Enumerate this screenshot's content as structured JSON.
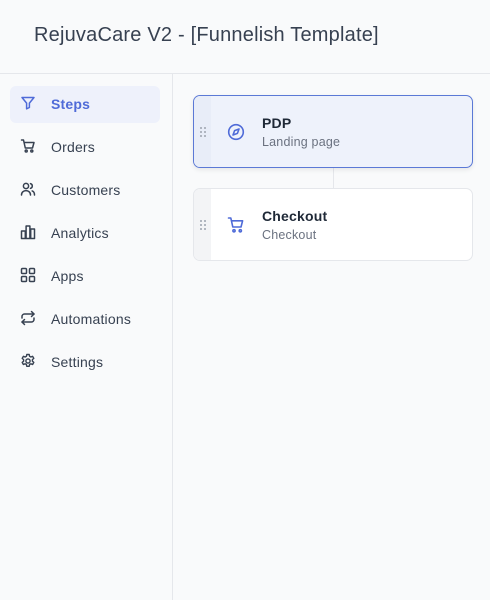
{
  "header": {
    "title": "RejuvaCare V2 - [Funnelish Template]"
  },
  "sidebar": {
    "items": [
      {
        "label": "Steps",
        "icon": "filter-icon",
        "active": true
      },
      {
        "label": "Orders",
        "icon": "cart-icon",
        "active": false
      },
      {
        "label": "Customers",
        "icon": "users-icon",
        "active": false
      },
      {
        "label": "Analytics",
        "icon": "bar-chart-icon",
        "active": false
      },
      {
        "label": "Apps",
        "icon": "grid-icon",
        "active": false
      },
      {
        "label": "Automations",
        "icon": "repeat-icon",
        "active": false
      },
      {
        "label": "Settings",
        "icon": "gear-icon",
        "active": false
      }
    ]
  },
  "steps": [
    {
      "name": "PDP",
      "type": "Landing page",
      "icon": "compass-icon",
      "selected": true
    },
    {
      "name": "Checkout",
      "type": "Checkout",
      "icon": "cart-icon",
      "selected": false
    }
  ],
  "colors": {
    "accent": "#4f6bd8",
    "active_bg": "#eef1fb",
    "border": "#e5e7eb"
  }
}
